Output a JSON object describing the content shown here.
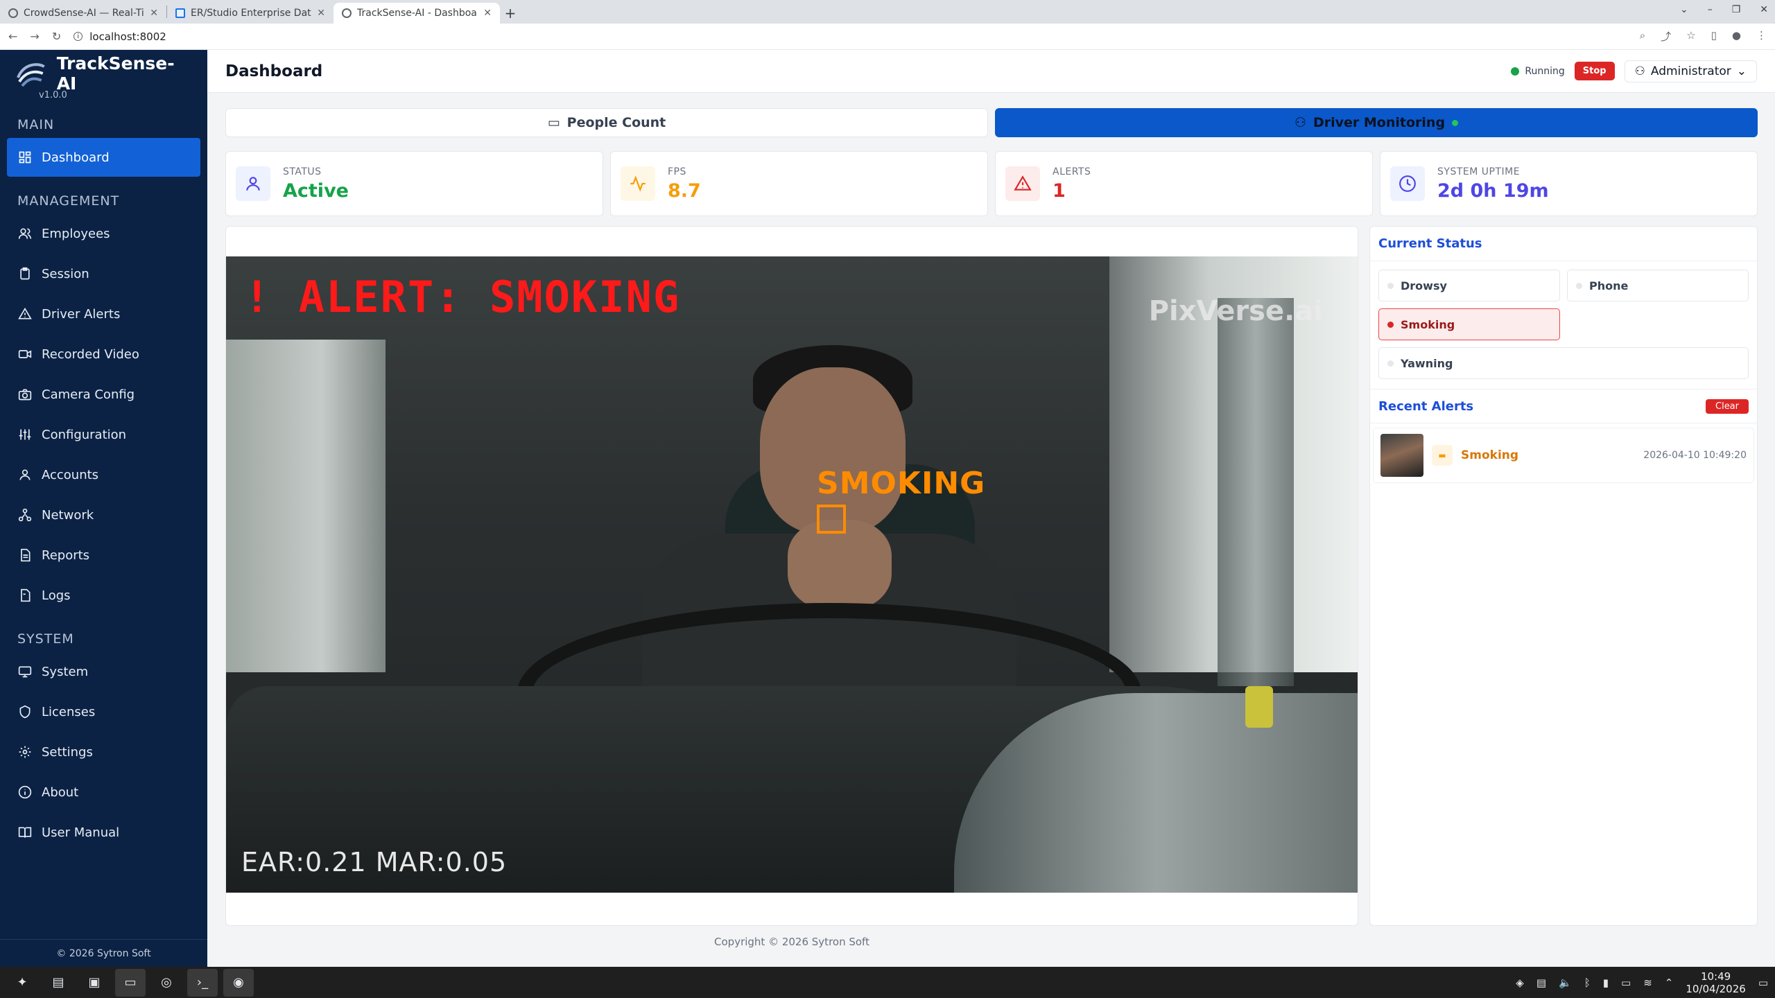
{
  "browser": {
    "tabs": [
      {
        "title": "CrowdSense-AI — Real-Tim",
        "active": false
      },
      {
        "title": "ER/Studio Enterprise Data",
        "active": false
      },
      {
        "title": "TrackSense-AI - Dashboard",
        "active": true
      }
    ],
    "url": "localhost:8002"
  },
  "sidebar": {
    "brand_name": "TrackSense-AI",
    "version": "v1.0.0",
    "sections": [
      {
        "label": "MAIN",
        "items": [
          {
            "label": "Dashboard",
            "icon": "grid-icon",
            "active": true
          }
        ]
      },
      {
        "label": "MANAGEMENT",
        "items": [
          {
            "label": "Employees",
            "icon": "users-icon"
          },
          {
            "label": "Session",
            "icon": "clipboard-icon"
          },
          {
            "label": "Driver Alerts",
            "icon": "warning-icon"
          },
          {
            "label": "Recorded Video",
            "icon": "video-icon"
          },
          {
            "label": "Camera Config",
            "icon": "camera-icon"
          },
          {
            "label": "Configuration",
            "icon": "sliders-icon"
          },
          {
            "label": "Accounts",
            "icon": "user-icon"
          },
          {
            "label": "Network",
            "icon": "network-icon"
          },
          {
            "label": "Reports",
            "icon": "document-icon"
          },
          {
            "label": "Logs",
            "icon": "log-icon"
          }
        ]
      },
      {
        "label": "SYSTEM",
        "items": [
          {
            "label": "System",
            "icon": "monitor-icon"
          },
          {
            "label": "Licenses",
            "icon": "shield-icon"
          },
          {
            "label": "Settings",
            "icon": "gear-icon"
          },
          {
            "label": "About",
            "icon": "info-icon"
          },
          {
            "label": "User Manual",
            "icon": "book-icon"
          }
        ]
      }
    ],
    "footer": "© 2026 Sytron Soft"
  },
  "topbar": {
    "title": "Dashboard",
    "running_label": "Running",
    "stop_label": "Stop",
    "user_label": "Administrator"
  },
  "mode_tabs": {
    "people_count": "People Count",
    "driver_monitoring": "Driver Monitoring"
  },
  "stats": [
    {
      "label": "STATUS",
      "value": "Active",
      "color": "#16a34a",
      "icon": "user-icon",
      "icon_bg": "#eef2ff",
      "icon_color": "#4f46e5"
    },
    {
      "label": "FPS",
      "value": "8.7",
      "color": "#f59e0b",
      "icon": "activity-icon",
      "icon_bg": "#fff7e6",
      "icon_color": "#f59e0b"
    },
    {
      "label": "ALERTS",
      "value": "1",
      "color": "#dc2626",
      "icon": "warning-icon",
      "icon_bg": "#fdecec",
      "icon_color": "#dc2626"
    },
    {
      "label": "SYSTEM UPTIME",
      "value": "2d 0h 19m",
      "color": "#4f46e5",
      "icon": "clock-icon",
      "icon_bg": "#eef2ff",
      "icon_color": "#4f46e5"
    }
  ],
  "video": {
    "alert_overlay": "! ALERT: SMOKING",
    "watermark": "PixVerse.ai",
    "detection_label": "SMOKING",
    "metrics": "EAR:0.21  MAR:0.05"
  },
  "current_status": {
    "title": "Current Status",
    "items": [
      {
        "label": "Drowsy",
        "active": false
      },
      {
        "label": "Phone",
        "active": false
      },
      {
        "label": "Smoking",
        "active": true
      },
      {
        "label": "Yawning",
        "active": false
      }
    ]
  },
  "recent_alerts": {
    "title": "Recent Alerts",
    "clear_label": "Clear",
    "items": [
      {
        "label": "Smoking",
        "timestamp": "2026-04-10 10:49:20"
      }
    ]
  },
  "footer": "Copyright © 2026 Sytron Soft",
  "taskbar": {
    "time": "10:49",
    "date": "10/04/2026"
  }
}
